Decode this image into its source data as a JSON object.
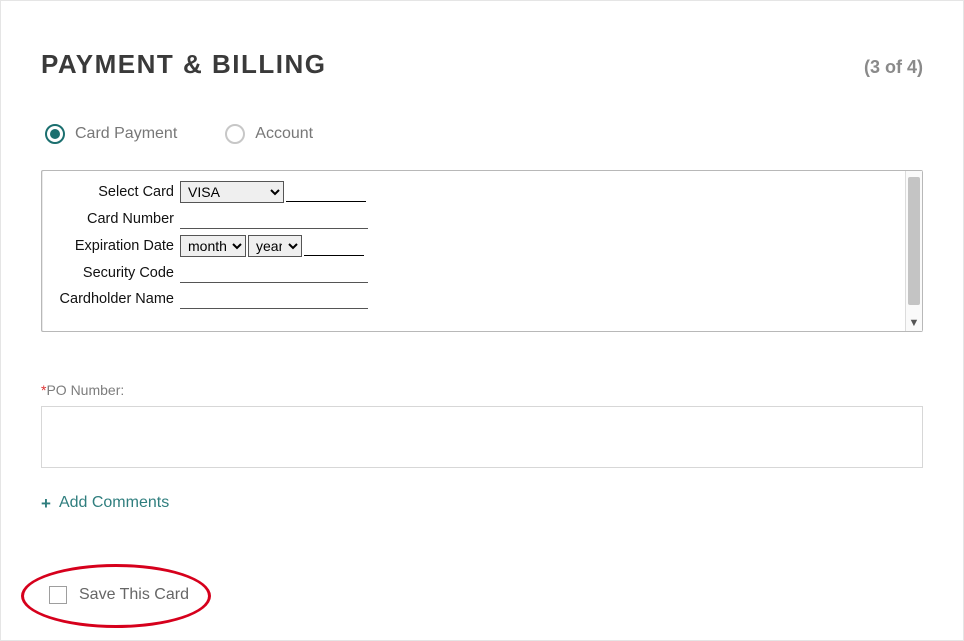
{
  "header": {
    "title": "PAYMENT & BILLING",
    "step": "(3 of 4)"
  },
  "paymentMethods": {
    "card": "Card Payment",
    "account": "Account"
  },
  "cardForm": {
    "selectCardLabel": "Select Card",
    "selectCardValue": "VISA",
    "cardNumberLabel": "Card Number",
    "cardNumberValue": "",
    "expirationLabel": "Expiration Date",
    "expirationMonthValue": "month",
    "expirationYearValue": "year",
    "securityCodeLabel": "Security Code",
    "securityCodeValue": "",
    "cardholderNameLabel": "Cardholder Name",
    "cardholderNameValue": ""
  },
  "po": {
    "required": "*",
    "label": "PO Number:",
    "value": ""
  },
  "addComments": {
    "plus": "+",
    "label": "Add Comments"
  },
  "saveCard": {
    "label": "Save This Card"
  }
}
